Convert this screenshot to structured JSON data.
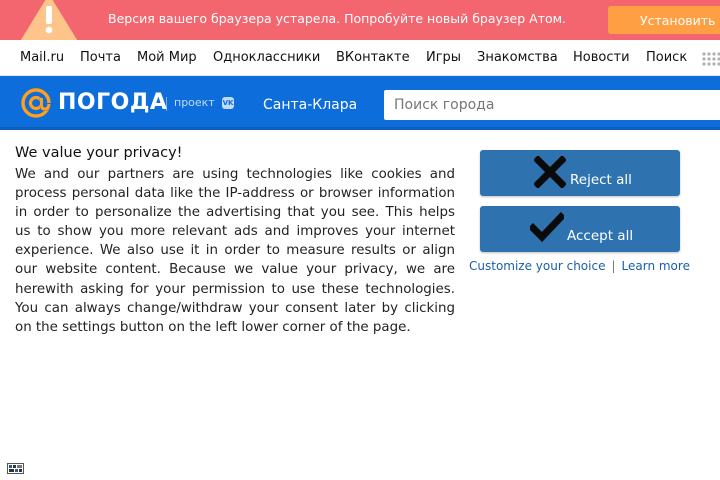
{
  "banner": {
    "message": "Версия вашего браузера устарела. Попробуйте новый браузер Атом.",
    "install_label": "Установить",
    "warning_icon": "warning-triangle-icon",
    "bg_color": "#f4666f",
    "install_color": "#ff9f43"
  },
  "portal": {
    "items": [
      "Mail.ru",
      "Почта",
      "Мой Мир",
      "Одноклассники",
      "ВКонтакте",
      "Игры",
      "Знакомства",
      "Новости",
      "Поиск"
    ],
    "apps_icon": "apps-grid-icon"
  },
  "header": {
    "logo_text": "ПОГОДА",
    "project_text": "проект",
    "vk_badge": "VK",
    "city": "Санта-Клара",
    "search_placeholder": "Поиск города",
    "bg_color": "#0d6ddb",
    "logo_accent": "#ff9f1c"
  },
  "consent": {
    "title": "We value your privacy!",
    "body": "We and our partners are using technologies like cookies and process personal data like the IP-address or browser information in order to personalize the advertising that you see. This helps us to show you more relevant ads and improves your internet experience. We also use it in order to measure results or align our website content. Because we value your privacy, we are herewith asking for your permission to use these technologies. You can always change/withdraw your consent later by clicking on the settings button on the left lower corner of the page.",
    "reject_label": "Reject all",
    "accept_label": "Accept all",
    "customize_label": "Customize your choice",
    "separator": "|",
    "learn_more_label": "Learn more",
    "button_color": "#2e73b0",
    "link_color": "#1a5fa8"
  }
}
